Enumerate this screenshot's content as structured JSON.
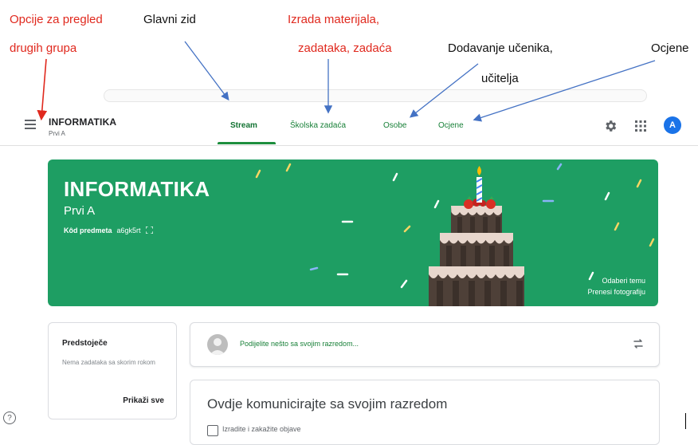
{
  "annotations": {
    "options_line1": "Opcije za pregled",
    "options_line2": "drugih grupa",
    "main_wall": "Glavni zid",
    "create_line1": "Izrada materijala,",
    "create_line2": "zadataka, zadaća",
    "add_line1": "Dodavanje učenika,",
    "add_line2": "učitelja",
    "grades": "Ocjene"
  },
  "header": {
    "class_name": "INFORMATIKA",
    "section": "Prvi A",
    "tabs": [
      {
        "label": "Stream",
        "active": true
      },
      {
        "label": "Školska zadaća",
        "active": false
      },
      {
        "label": "Osobe",
        "active": false
      },
      {
        "label": "Ocjene",
        "active": false
      }
    ],
    "avatar_letter": "A"
  },
  "banner": {
    "title": "INFORMATIKA",
    "subtitle": "Prvi A",
    "code_label": "Kôd predmeta",
    "code_value": "a6gk5rt",
    "select_theme": "Odaberi temu",
    "upload_photo": "Prenesi fotografiju",
    "color": "#1e9e63"
  },
  "upcoming": {
    "title": "Predstoječe",
    "description": "Nema zadataka sa skorim rokom",
    "view_all": "Prikaži sve"
  },
  "share": {
    "placeholder": "Podijelite nešto sa svojim razredom..."
  },
  "communicate": {
    "heading": "Ovdje komunicirajte sa svojim razredom",
    "checkbox_label": "Izradite i zakažite objave"
  },
  "colors": {
    "annotation_red": "#e0291e",
    "arrow_blue": "#4472c4",
    "tab_green": "#188038",
    "avatar_blue": "#1a73e8"
  }
}
